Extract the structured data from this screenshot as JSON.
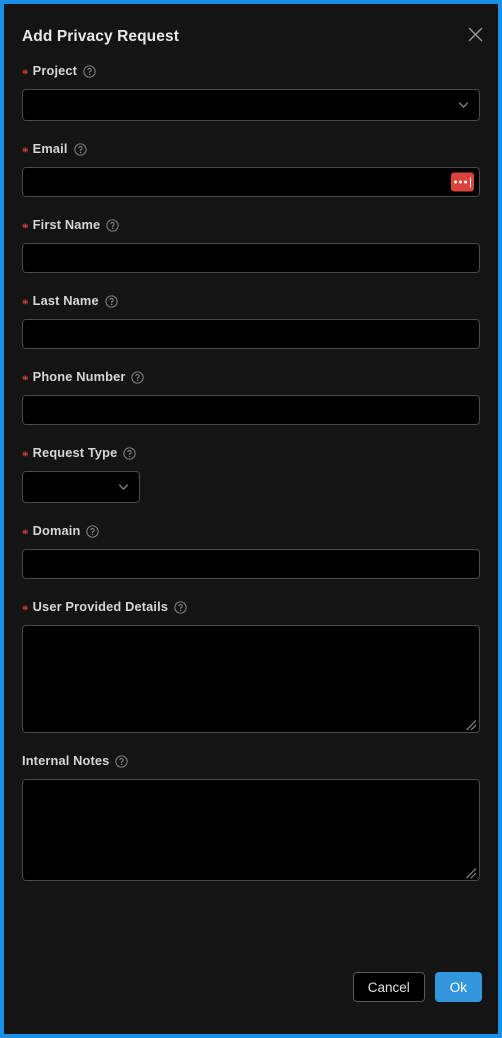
{
  "dialog": {
    "title": "Add Privacy Request",
    "close_label": "×",
    "accent_color": "#1890e8",
    "surface_color": "#141414",
    "input_color": "#000000",
    "required_marker": "*",
    "required_marker_color": "#d9453d",
    "help_icon": "question-circle-icon"
  },
  "fields": {
    "project": {
      "label": "Project",
      "required": true,
      "control": "select",
      "value": "",
      "placeholder": "",
      "help_icon": "question-circle-icon",
      "chevron_icon": "chevron-down-icon"
    },
    "email": {
      "label": "Email",
      "required": true,
      "control": "text",
      "value": "",
      "placeholder": "",
      "help_icon": "question-circle-icon",
      "badge_icon": "masked-value-icon",
      "badge_color": "#d9453d"
    },
    "first_name": {
      "label": "First Name",
      "required": true,
      "control": "text",
      "value": "",
      "placeholder": "",
      "help_icon": "question-circle-icon"
    },
    "last_name": {
      "label": "Last Name",
      "required": true,
      "control": "text",
      "value": "",
      "placeholder": "",
      "help_icon": "question-circle-icon"
    },
    "phone_number": {
      "label": "Phone Number",
      "required": true,
      "control": "text",
      "value": "",
      "placeholder": "",
      "help_icon": "question-circle-icon"
    },
    "request_type": {
      "label": "Request Type",
      "required": true,
      "control": "select",
      "value": "",
      "placeholder": "",
      "help_icon": "question-circle-icon",
      "chevron_icon": "chevron-down-icon"
    },
    "domain": {
      "label": "Domain",
      "required": true,
      "control": "text",
      "value": "",
      "placeholder": "",
      "help_icon": "question-circle-icon"
    },
    "user_provided_details": {
      "label": "User Provided Details",
      "required": true,
      "control": "textarea",
      "value": "",
      "placeholder": "",
      "help_icon": "question-circle-icon",
      "resize_icon": "resize-grip-icon"
    },
    "internal_notes": {
      "label": "Internal Notes",
      "required": false,
      "control": "textarea",
      "value": "",
      "placeholder": "",
      "help_icon": "question-circle-icon",
      "resize_icon": "resize-grip-icon"
    }
  },
  "footer": {
    "cancel_label": "Cancel",
    "ok_label": "Ok",
    "ok_color": "#3296dc"
  }
}
